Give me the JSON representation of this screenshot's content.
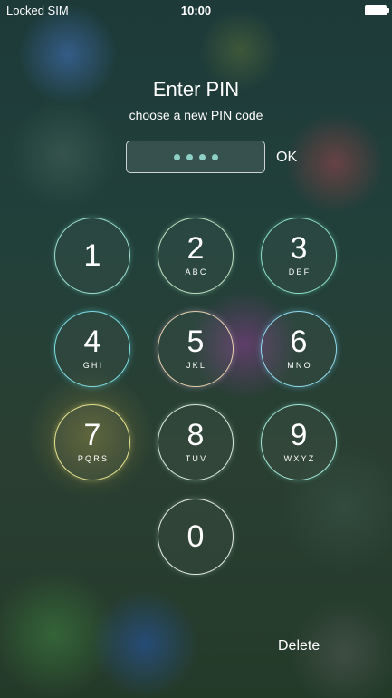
{
  "status_bar": {
    "carrier": "Locked SIM",
    "time": "10:00",
    "battery_icon": "battery-full-icon"
  },
  "header": {
    "title": "Enter PIN",
    "subtitle": "choose a new PIN code"
  },
  "pin_entry": {
    "entered_digits": 4,
    "ok_label": "OK"
  },
  "keypad": {
    "keys": [
      {
        "digit": "1",
        "letters": ""
      },
      {
        "digit": "2",
        "letters": "ABC"
      },
      {
        "digit": "3",
        "letters": "DEF"
      },
      {
        "digit": "4",
        "letters": "GHI"
      },
      {
        "digit": "5",
        "letters": "JKL"
      },
      {
        "digit": "6",
        "letters": "MNO"
      },
      {
        "digit": "7",
        "letters": "PQRS"
      },
      {
        "digit": "8",
        "letters": "TUV"
      },
      {
        "digit": "9",
        "letters": "WXYZ"
      },
      {
        "digit": "0",
        "letters": ""
      }
    ]
  },
  "footer": {
    "delete_label": "Delete"
  },
  "colors": {
    "text": "#ffffff",
    "pin_dot": "#8fd0c6"
  }
}
